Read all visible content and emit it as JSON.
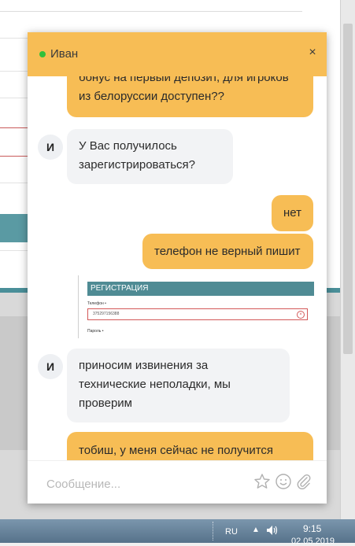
{
  "chat": {
    "agent_name": "Иван",
    "close_glyph": "×",
    "messages": [
      {
        "from": "user",
        "lines": [
          "бонус на первый депозит, для игроков",
          "из белоруссии доступен??"
        ]
      },
      {
        "from": "agent",
        "avatar": "И",
        "lines": [
          "У Вас получилось",
          "зарегистрироваться?"
        ]
      },
      {
        "from": "user",
        "lines": [
          "нет"
        ]
      },
      {
        "from": "user",
        "lines": [
          "телефон не верный пишит"
        ]
      },
      {
        "from": "agent",
        "avatar": "И",
        "lines": [
          "приносим извинения за",
          "технические неполадки, мы",
          "проверим"
        ]
      },
      {
        "from": "user",
        "lines": [
          "тобиш, у меня сейчас не получится"
        ]
      }
    ],
    "attachment": {
      "header": "РЕГИСТРАЦИЯ",
      "phone_label": "Телефон •",
      "phone_value": "375297156388",
      "clear_glyph": "×",
      "password_label": "Пароль •"
    },
    "composer": {
      "placeholder": "Сообщение...",
      "icons": [
        "star-icon",
        "smile-icon",
        "paperclip-icon"
      ]
    }
  },
  "taskbar": {
    "language": "RU",
    "arrow": "▲",
    "time": "9:15",
    "date": "02.05.2019"
  },
  "colors": {
    "accent": "#f7bd55",
    "agent_bubble": "#f2f3f5",
    "online": "#33c03a",
    "teal": "#4f8b94"
  }
}
